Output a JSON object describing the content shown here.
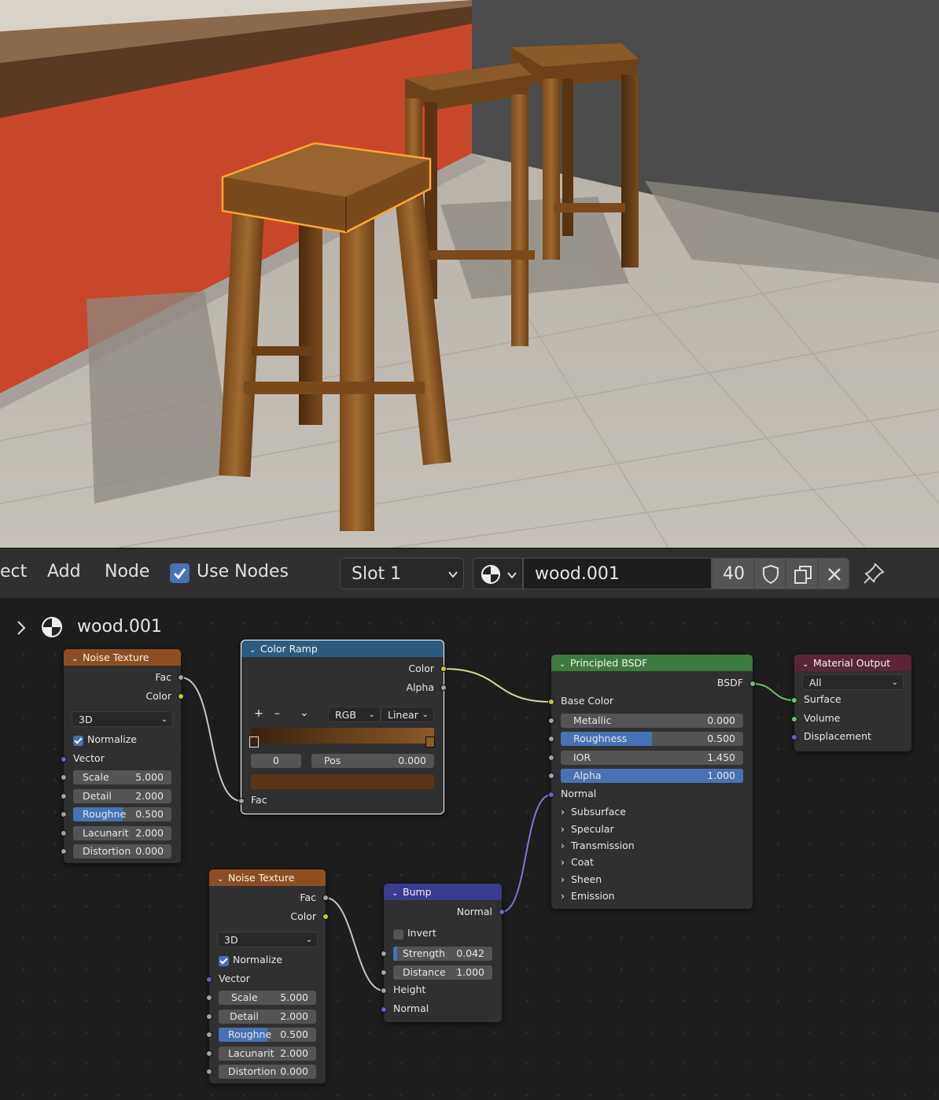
{
  "header": {
    "menu": [
      "ect",
      "Add",
      "Node"
    ],
    "use_nodes": "Use Nodes",
    "slot": "Slot 1",
    "material_name": "wood.001",
    "user_count": "40"
  },
  "breadcrumb": {
    "material": "wood.001"
  },
  "nodes": {
    "noise1": {
      "title": "Noise Texture",
      "out_fac": "Fac",
      "out_color": "Color",
      "dimensions": "3D",
      "normalize": "Normalize",
      "vector": "Vector",
      "fields": [
        {
          "label": "Scale",
          "value": "5.000"
        },
        {
          "label": "Detail",
          "value": "2.000"
        },
        {
          "label": "Roughne",
          "value": "0.500"
        },
        {
          "label": "Lacunarit",
          "value": "2.000"
        },
        {
          "label": "Distortion",
          "value": "0.000"
        }
      ]
    },
    "colorramp": {
      "title": "Color Ramp",
      "out_color": "Color",
      "out_alpha": "Alpha",
      "plus": "+",
      "minus": "–",
      "mode": "RGB",
      "interp": "Linear",
      "index": "0",
      "pos_label": "Pos",
      "pos_value": "0.000",
      "in_fac": "Fac",
      "colors": {
        "left": "#3a2210",
        "right": "#8a5a28",
        "swatch": "#5a3516"
      }
    },
    "bsdf": {
      "title": "Principled BSDF",
      "out": "BSDF",
      "base_color": "Base Color",
      "fields": [
        {
          "label": "Metallic",
          "value": "0.000",
          "fill": 0
        },
        {
          "label": "Roughness",
          "value": "0.500",
          "fill": 0.5
        },
        {
          "label": "IOR",
          "value": "1.450",
          "fill": 0
        },
        {
          "label": "Alpha",
          "value": "1.000",
          "fill": 1
        }
      ],
      "normal": "Normal",
      "panels": [
        "Subsurface",
        "Specular",
        "Transmission",
        "Coat",
        "Sheen",
        "Emission"
      ]
    },
    "output": {
      "title": "Material Output",
      "target": "All",
      "inputs": [
        "Surface",
        "Volume",
        "Displacement"
      ]
    },
    "noise2": {
      "title": "Noise Texture",
      "out_fac": "Fac",
      "out_color": "Color",
      "dimensions": "3D",
      "normalize": "Normalize",
      "vector": "Vector",
      "fields": [
        {
          "label": "Scale",
          "value": "5.000"
        },
        {
          "label": "Detail",
          "value": "2.000"
        },
        {
          "label": "Roughne",
          "value": "0.500"
        },
        {
          "label": "Lacunarit",
          "value": "2.000"
        },
        {
          "label": "Distortion",
          "value": "0.000"
        }
      ]
    },
    "bump": {
      "title": "Bump",
      "out_normal": "Normal",
      "invert": "Invert",
      "fields": [
        {
          "label": "Strength",
          "value": "0.042",
          "fill": 0.042
        },
        {
          "label": "Distance",
          "value": "1.000",
          "fill": 0
        }
      ],
      "in_height": "Height",
      "in_normal": "Normal"
    }
  },
  "colors": {
    "texture_header": "#8c4f21",
    "converter_header": "#2b5c80",
    "shader_header": "#3d7a3d",
    "output_header": "#5c2435",
    "vector_header": "#3b3b8f",
    "selection": "#ffa733"
  }
}
